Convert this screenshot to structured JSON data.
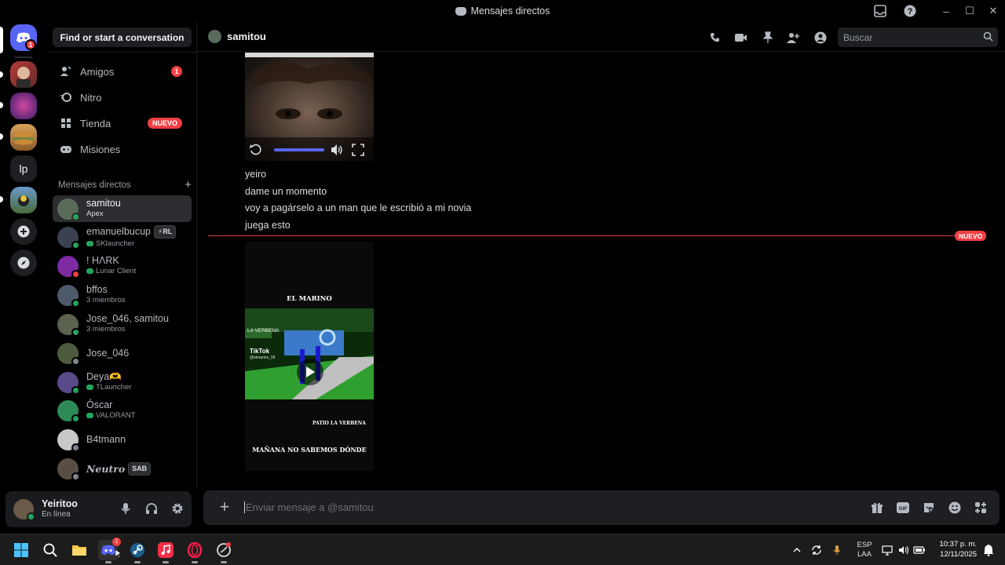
{
  "window": {
    "title": "Mensajes directos"
  },
  "sidebar": {
    "find_label": "Find or start a conversation",
    "nav": [
      {
        "label": "Amigos",
        "badge": "1"
      },
      {
        "label": "Nitro"
      },
      {
        "label": "Tienda",
        "badge": "NUEVO"
      },
      {
        "label": "Misiones"
      }
    ],
    "dm_header": "Mensajes directos",
    "dms": [
      {
        "name": "samitou",
        "sub": "Apex",
        "status": "on",
        "color": "#5a6b5a"
      },
      {
        "name": "emanuelbucup",
        "tag": "⚡RL",
        "sub": "SKlauncher",
        "status": "on",
        "color": "#3a4250"
      },
      {
        "name": "! HΛRK",
        "sub": "Lunar Client",
        "status": "dnd",
        "color": "#7d2aa3"
      },
      {
        "name": "bffos",
        "sub": "3 miembros",
        "status": "on",
        "color": "#4d5a6a"
      },
      {
        "name": "Jose_046, samitou",
        "sub": "3 miembros",
        "status": "on",
        "color": "#5b6350"
      },
      {
        "name": "Jose_046",
        "sub": "",
        "status": "off",
        "color": "#4e5a3e"
      },
      {
        "name": "Deya🫶",
        "sub": "TLauncher",
        "status": "on",
        "color": "#5b4a8a"
      },
      {
        "name": "Óscar",
        "sub": "VALORANT",
        "status": "on",
        "color": "#2e8b57"
      },
      {
        "name": "B4tmann",
        "sub": "",
        "status": "off",
        "color": "#c8c8c8"
      },
      {
        "name": "Neutro",
        "tag": "SAB",
        "sub": "",
        "status": "off",
        "color": "#5a4e44"
      }
    ]
  },
  "user": {
    "name": "Yeiritoo",
    "status": "En línea"
  },
  "chat": {
    "recipient": "samitou",
    "search_placeholder": "Buscar",
    "messages": [
      "yeiro",
      "dame un momento",
      "voy a pagárselo a un man que le escribió a mi novia",
      "juega esto"
    ],
    "new_divider": "NUEVO",
    "video": {
      "top_text": "EL MARINO",
      "tiktok": "TikTok",
      "handle": "@elmarino_06",
      "banner": "LA VERBENA",
      "sub_caption": "PATIO LA VERBENA",
      "caption": "MAÑANA NO SABEMOS DÓNDE"
    },
    "composer_placeholder": "Enviar mensaje a @samitou"
  },
  "taskbar": {
    "lang": "ESP",
    "region": "LAA",
    "time": "10:37 p. m.",
    "date": "12/11/2025",
    "discord_badge": "1"
  },
  "rail": {
    "discord_badge": "1",
    "server_text": "lp"
  }
}
